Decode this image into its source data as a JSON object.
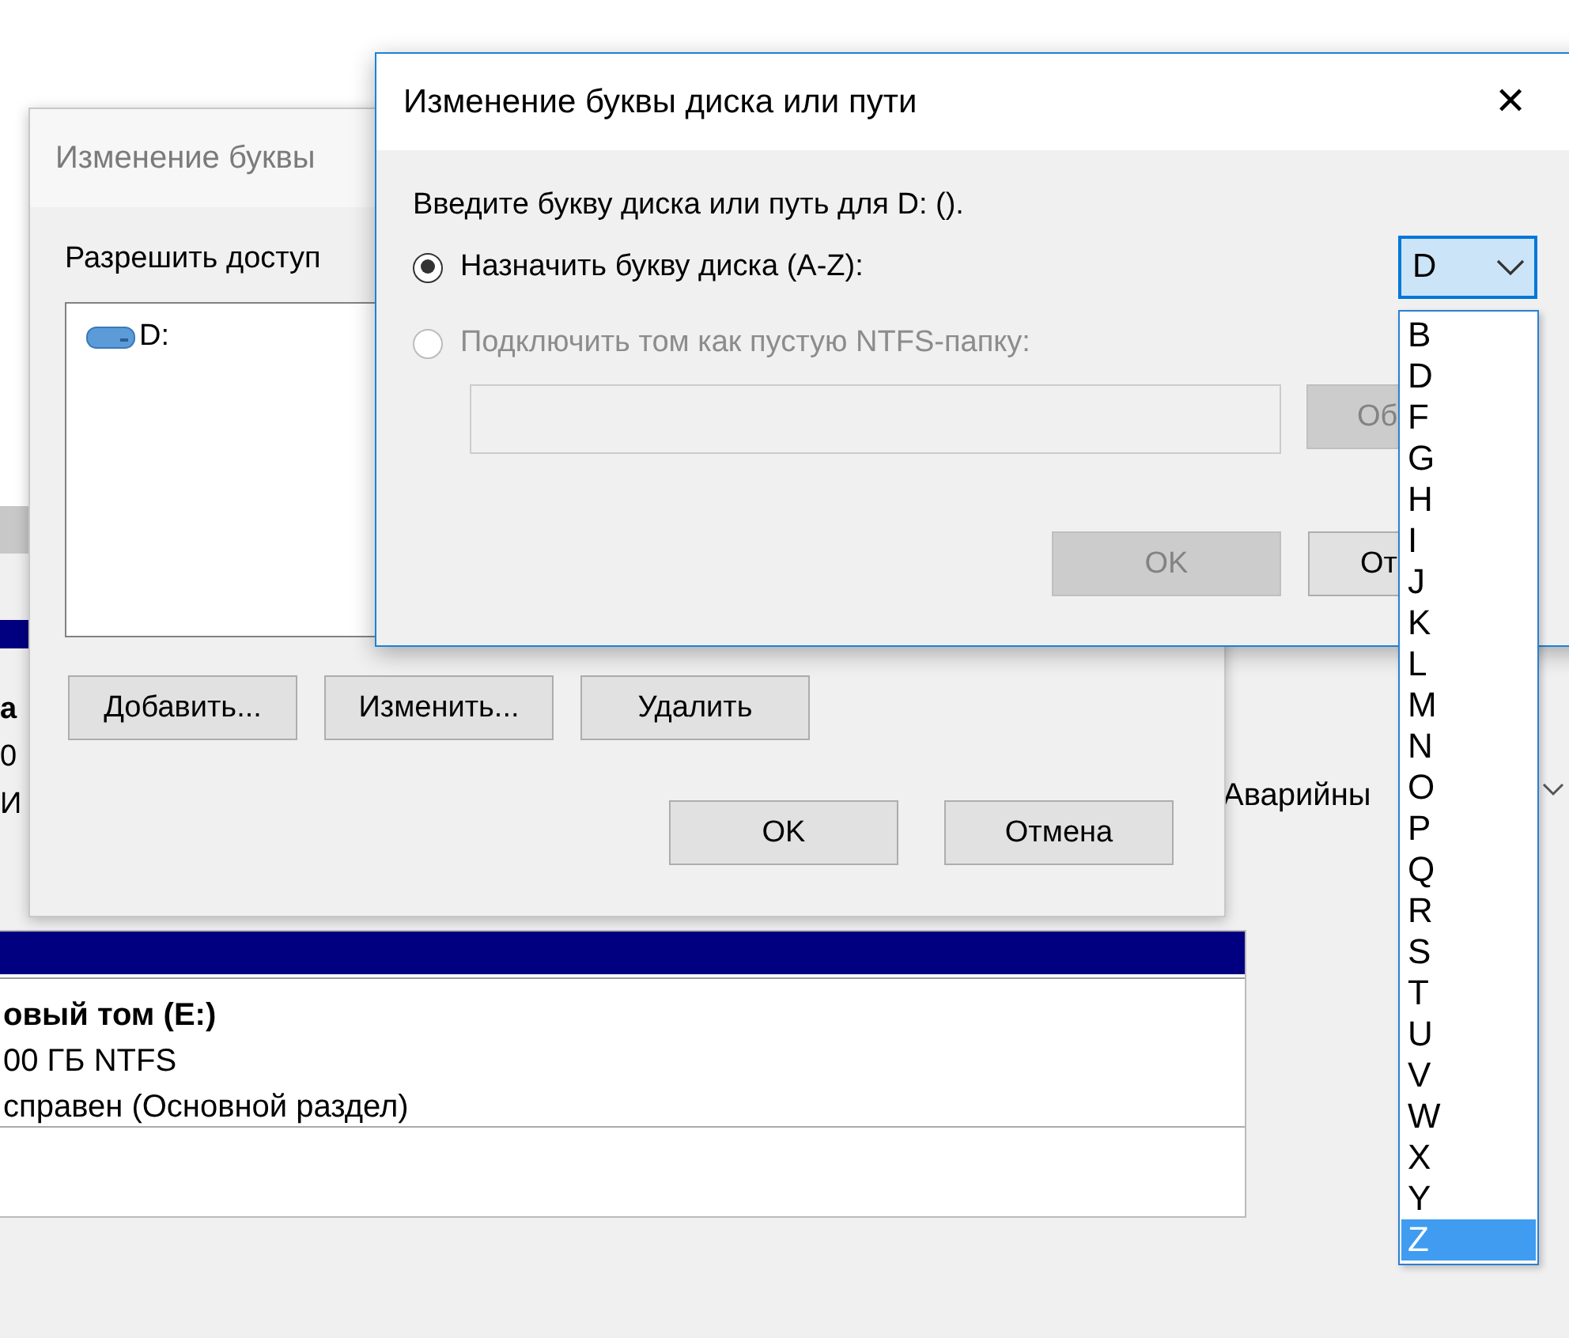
{
  "background": {
    "row_fragments": [
      {
        "text": "а",
        "bold": true
      },
      {
        "text": "0",
        "bold": false
      },
      {
        "text": "И",
        "bold": false
      }
    ],
    "status_text": "Аварийны",
    "volume": {
      "name": "овый том  (E:)",
      "size": "00 ГБ NTFS",
      "status": "справен (Основной раздел)"
    }
  },
  "back_dialog": {
    "title": "Изменение буквы",
    "prompt": "Разрешить доступ",
    "drives": [
      {
        "label": "D:",
        "selected": false
      }
    ],
    "buttons": [
      "Добавить...",
      "Изменить...",
      "Удалить"
    ],
    "footer_buttons": [
      "OK",
      "Отмена"
    ]
  },
  "front_dialog": {
    "title": "Изменение буквы диска или пути",
    "close": "✕",
    "instruction": "Введите букву диска или путь для D: ().",
    "options": [
      {
        "label": "Назначить букву диска (A-Z):",
        "selected": true,
        "disabled": false
      },
      {
        "label": "Подключить том как пустую NTFS-папку:",
        "selected": false,
        "disabled": true
      }
    ],
    "letter_combo": {
      "value": "D",
      "expanded": true
    },
    "path_field": {
      "disabled": true
    },
    "browse_button": {
      "label": "Об",
      "disabled": true
    },
    "buttons": [
      {
        "label": "OK",
        "disabled": true
      },
      {
        "label": "От",
        "disabled": false
      }
    ]
  },
  "letter_list": [
    {
      "letter": "B",
      "selected": false
    },
    {
      "letter": "D",
      "selected": false
    },
    {
      "letter": "F",
      "selected": false
    },
    {
      "letter": "G",
      "selected": false
    },
    {
      "letter": "H",
      "selected": false
    },
    {
      "letter": "I",
      "selected": false
    },
    {
      "letter": "J",
      "selected": false
    },
    {
      "letter": "K",
      "selected": false
    },
    {
      "letter": "L",
      "selected": false
    },
    {
      "letter": "M",
      "selected": false
    },
    {
      "letter": "N",
      "selected": false
    },
    {
      "letter": "O",
      "selected": false
    },
    {
      "letter": "P",
      "selected": false
    },
    {
      "letter": "Q",
      "selected": false
    },
    {
      "letter": "R",
      "selected": false
    },
    {
      "letter": "S",
      "selected": false
    },
    {
      "letter": "T",
      "selected": false
    },
    {
      "letter": "U",
      "selected": false
    },
    {
      "letter": "V",
      "selected": false
    },
    {
      "letter": "W",
      "selected": false
    },
    {
      "letter": "X",
      "selected": false
    },
    {
      "letter": "Y",
      "selected": false
    },
    {
      "letter": "Z",
      "selected": true
    }
  ]
}
